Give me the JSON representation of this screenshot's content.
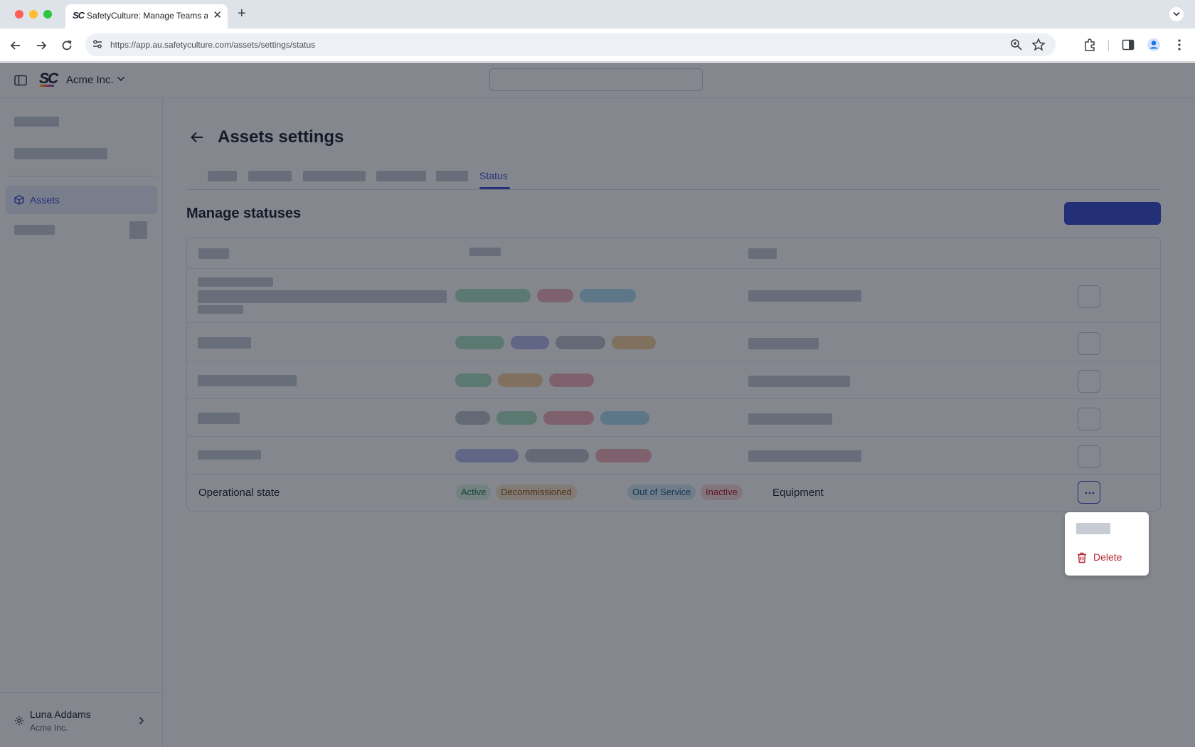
{
  "browser": {
    "tab_title": "SafetyCulture: Manage Teams and...",
    "url": "https://app.au.safetyculture.com/assets/settings/status"
  },
  "header": {
    "logo_text": "SC",
    "org_name": "Acme Inc."
  },
  "sidebar": {
    "active_item": "Assets",
    "user_name": "Luna Addams",
    "user_org": "Acme Inc."
  },
  "page": {
    "title": "Assets settings",
    "active_tab": "Status",
    "section_title": "Manage statuses"
  },
  "table": {
    "row": {
      "name": "Operational state",
      "statuses": [
        "Active",
        "Decommissioned",
        "Out of Service",
        "Inactive"
      ],
      "type": "Equipment"
    }
  },
  "menu": {
    "delete_label": "Delete"
  },
  "colors": {
    "accent": "#3d4ed1",
    "danger": "#b4232f"
  }
}
